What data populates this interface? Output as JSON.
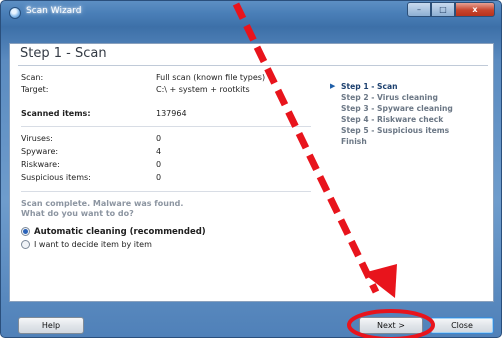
{
  "window": {
    "title": "Scan Wizard",
    "close_glyph": "x",
    "minimize_glyph": "–",
    "maximize_glyph": "□"
  },
  "page": {
    "title": "Step 1 - Scan"
  },
  "scan_info": {
    "scan_label": "Scan:",
    "scan_value": "Full scan (known file types)",
    "target_label": "Target:",
    "target_value": "C:\\  + system + rootkits",
    "scanned_label": "Scanned items:",
    "scanned_value": "137964"
  },
  "threats": [
    {
      "label": "Viruses:",
      "value": "0"
    },
    {
      "label": "Spyware:",
      "value": "4"
    },
    {
      "label": "Riskware:",
      "value": "0"
    },
    {
      "label": "Suspicious items:",
      "value": "0"
    }
  ],
  "message": {
    "line1": "Scan complete. Malware was found.",
    "line2": "What do you want to do?"
  },
  "options": [
    {
      "label": "Automatic cleaning (recommended)",
      "selected": true
    },
    {
      "label": "I want to decide item by item",
      "selected": false
    }
  ],
  "steps": [
    {
      "label": "Step 1 - Scan",
      "active": true
    },
    {
      "label": "Step 2 - Virus cleaning",
      "active": false
    },
    {
      "label": "Step 3 - Spyware cleaning",
      "active": false
    },
    {
      "label": "Step 4 - Riskware check",
      "active": false
    },
    {
      "label": "Step 5 - Suspicious items",
      "active": false
    },
    {
      "label": "Finish",
      "active": false
    }
  ],
  "buttons": {
    "help": "Help",
    "next": "Next >",
    "close": "Close"
  },
  "annotation": {
    "arrow_color": "#e8141c",
    "circle_color": "#e8141c"
  }
}
